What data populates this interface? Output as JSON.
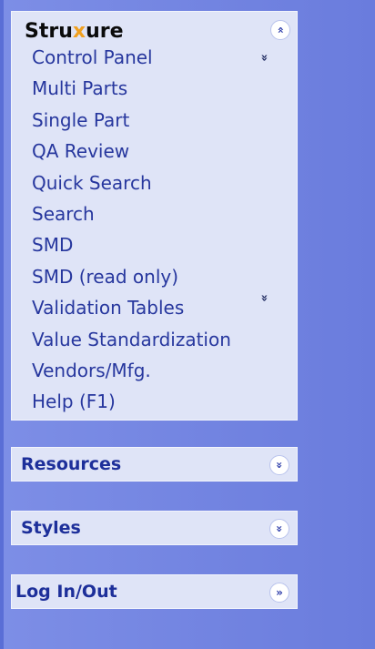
{
  "app": {
    "title_prefix": "Stru",
    "title_x": "x",
    "title_suffix": "ure"
  },
  "main_panel": {
    "collapse_icon": "⌃",
    "menu_items": [
      "Control Panel",
      "Multi Parts",
      "Single Part",
      "QA Review",
      "Quick Search",
      "Search",
      "SMD",
      "SMD (read only)",
      "Validation Tables",
      "Value Standardization",
      "Vendors/Mfg.",
      "Help (F1)"
    ],
    "scroll_icon": "»"
  },
  "sections": {
    "resources": {
      "label": "Resources",
      "icon": "»"
    },
    "styles": {
      "label": "Styles",
      "icon": "»"
    },
    "login": {
      "label": "Log In/Out",
      "icon": "»"
    }
  },
  "colors": {
    "background": "#6b7fe0",
    "panel": "#dfe4f7",
    "link": "#27379e",
    "section_title": "#1d2f9a",
    "brand_accent": "#f0a020"
  }
}
